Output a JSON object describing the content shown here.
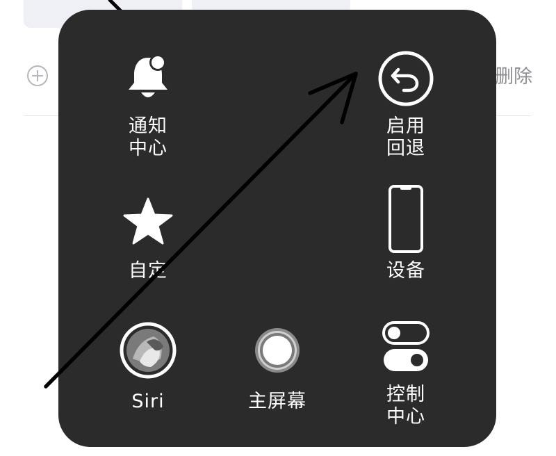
{
  "background": {
    "add_label": "",
    "delete_label": "删除"
  },
  "menu": {
    "items": [
      {
        "id": "notification",
        "label": "通知\n中心",
        "icon": "bell-icon"
      },
      {
        "id": "enable-back",
        "label": "启用\n回退",
        "icon": "back-arrow-icon"
      },
      {
        "id": "custom",
        "label": "自定",
        "icon": "star-icon"
      },
      {
        "id": "device",
        "label": "设备",
        "icon": "phone-icon"
      },
      {
        "id": "siri",
        "label": "Siri",
        "icon": "siri-icon"
      },
      {
        "id": "home",
        "label": "主屏幕",
        "icon": "home-button-icon"
      },
      {
        "id": "control-center",
        "label": "控制\n中心",
        "icon": "toggles-icon"
      }
    ]
  },
  "colors": {
    "menu_background": "#2b2b2b",
    "icon_white": "#ffffff",
    "annotation_arrow": "#000000"
  }
}
